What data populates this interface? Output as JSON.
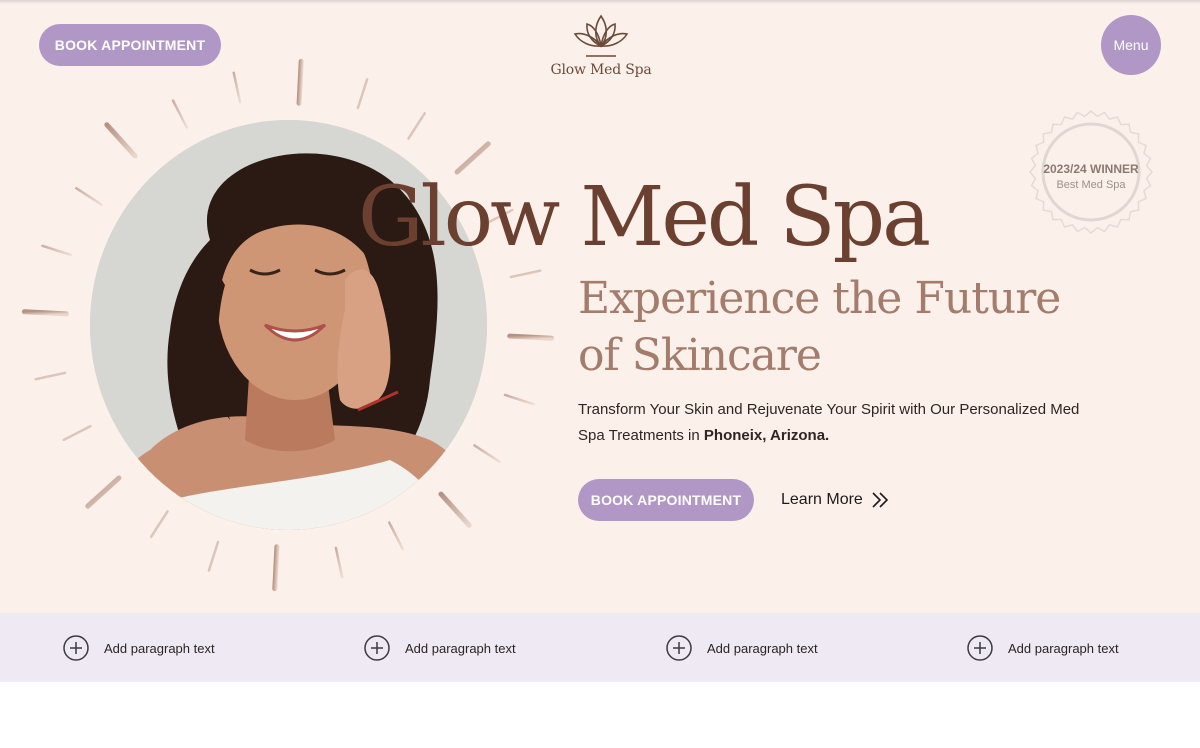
{
  "header": {
    "book_label": "BOOK APPOINTMENT",
    "logo_text": "Glow Med Spa",
    "menu_label": "Menu"
  },
  "badge": {
    "line1": "2023/24 WINNER",
    "line2": "Best Med Spa"
  },
  "hero": {
    "title": "Glow Med Spa",
    "subtitle_line1": "Experience the Future",
    "subtitle_line2": "of Skincare",
    "description": "Transform Your Skin and Rejuvenate Your Spirit with Our Personalized Med Spa Treatments in ",
    "location": "Phoneix, Arizona.",
    "book_label": "BOOK APPOINTMENT",
    "learn_more": "Learn More"
  },
  "features": [
    {
      "label": "Add paragraph text",
      "icon": "plus-circle-icon"
    },
    {
      "label": "Add paragraph text",
      "icon": "plus-circle-icon"
    },
    {
      "label": "Add paragraph text",
      "icon": "plus-circle-icon"
    },
    {
      "label": "Add paragraph text",
      "icon": "plus-circle-icon"
    }
  ],
  "colors": {
    "hero_bg": "#fcf0eb",
    "accent": "#b197c5",
    "title": "#6b4030",
    "subtitle": "#a37c6c",
    "features_bg": "#efe9f3"
  }
}
